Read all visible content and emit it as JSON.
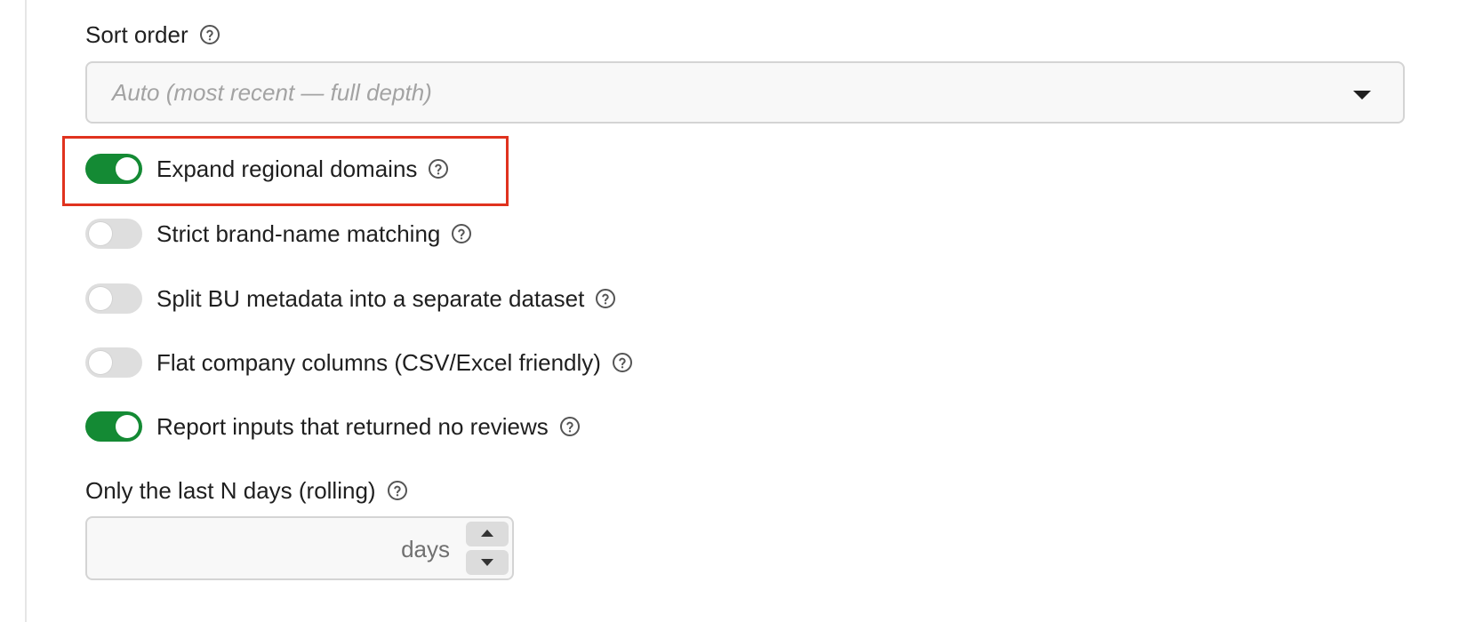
{
  "sort_order": {
    "label": "Sort order",
    "placeholder": "Auto (most recent — full depth)"
  },
  "toggles": [
    {
      "label": "Expand regional domains",
      "on": true
    },
    {
      "label": "Strict brand-name matching",
      "on": false
    },
    {
      "label": "Split BU metadata into a separate dataset",
      "on": false
    },
    {
      "label": "Flat company columns (CSV/Excel friendly)",
      "on": false
    },
    {
      "label": "Report inputs that returned no reviews",
      "on": true
    }
  ],
  "last_n_days": {
    "label": "Only the last N days (rolling)",
    "unit": "days"
  },
  "colors": {
    "toggle_on": "#148a34",
    "toggle_off": "#dedede",
    "highlight": "#e0321e"
  },
  "icons": {
    "help": "help-circle-icon",
    "dropdown": "caret-down-icon",
    "increment": "caret-up-icon",
    "decrement": "caret-down-icon"
  }
}
